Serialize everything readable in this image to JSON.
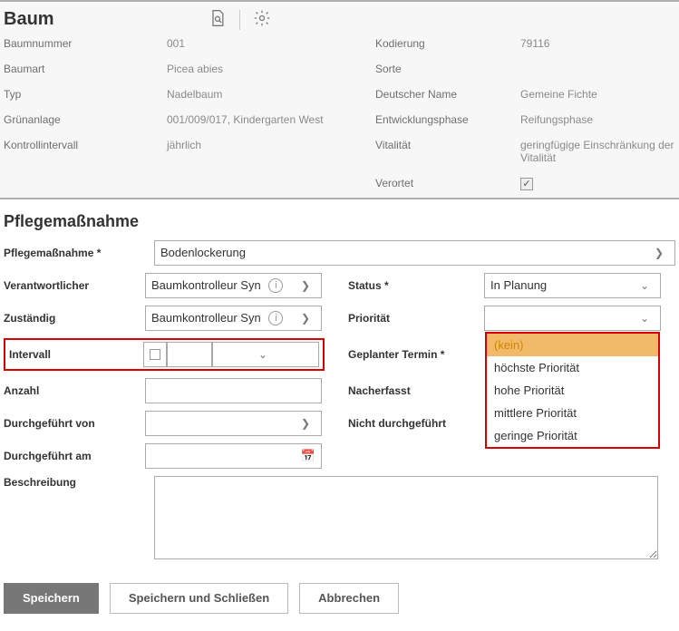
{
  "header": {
    "title": "Baum"
  },
  "details": {
    "labels": {
      "baumnummer": "Baumnummer",
      "baumart": "Baumart",
      "typ": "Typ",
      "gruenanlage": "Grünanlage",
      "kontrollintervall": "Kontrollintervall",
      "kodierung": "Kodierung",
      "sorte": "Sorte",
      "deutscher_name": "Deutscher Name",
      "entwicklungsphase": "Entwicklungsphase",
      "vitalitaet": "Vitalität",
      "verortet": "Verortet"
    },
    "values": {
      "baumnummer": "001",
      "baumart": "Picea abies",
      "typ": "Nadelbaum",
      "gruenanlage": "001/009/017, Kindergarten West",
      "kontrollintervall": "jährlich",
      "kodierung": "79116",
      "sorte": "",
      "deutscher_name": "Gemeine Fichte",
      "entwicklungsphase": "Reifungsphase",
      "vitalitaet": "geringfügige Einschränkung der Vitalität"
    }
  },
  "section_title": "Pflegemaßnahme",
  "form": {
    "labels": {
      "pflegemassnahme": "Pflegemaßnahme *",
      "verantwortlicher": "Verantwortlicher",
      "zustaendig": "Zuständig",
      "intervall": "Intervall",
      "anzahl": "Anzahl",
      "durchgefuehrt_von": "Durchgeführt von",
      "durchgefuehrt_am": "Durchgeführt am",
      "beschreibung": "Beschreibung",
      "status": "Status *",
      "prioritaet": "Priorität",
      "geplanter_termin": "Geplanter Termin *",
      "nacherfasst": "Nacherfasst",
      "nicht_durchgefuehrt": "Nicht durchgeführt"
    },
    "values": {
      "pflegemassnahme": "Bodenlockerung",
      "verantwortlicher": "Baumkontrolleur SynerGIS",
      "zustaendig": "Baumkontrolleur SynerGIS",
      "status": "In Planung",
      "prioritaet": "",
      "anzahl": "",
      "durchgefuehrt_von": "",
      "durchgefuehrt_am": "",
      "beschreibung": ""
    },
    "priority_options": [
      "(kein)",
      "höchste Priorität",
      "hohe Priorität",
      "mittlere Priorität",
      "geringe Priorität"
    ]
  },
  "buttons": {
    "save": "Speichern",
    "save_close": "Speichern und Schließen",
    "cancel": "Abbrechen"
  }
}
